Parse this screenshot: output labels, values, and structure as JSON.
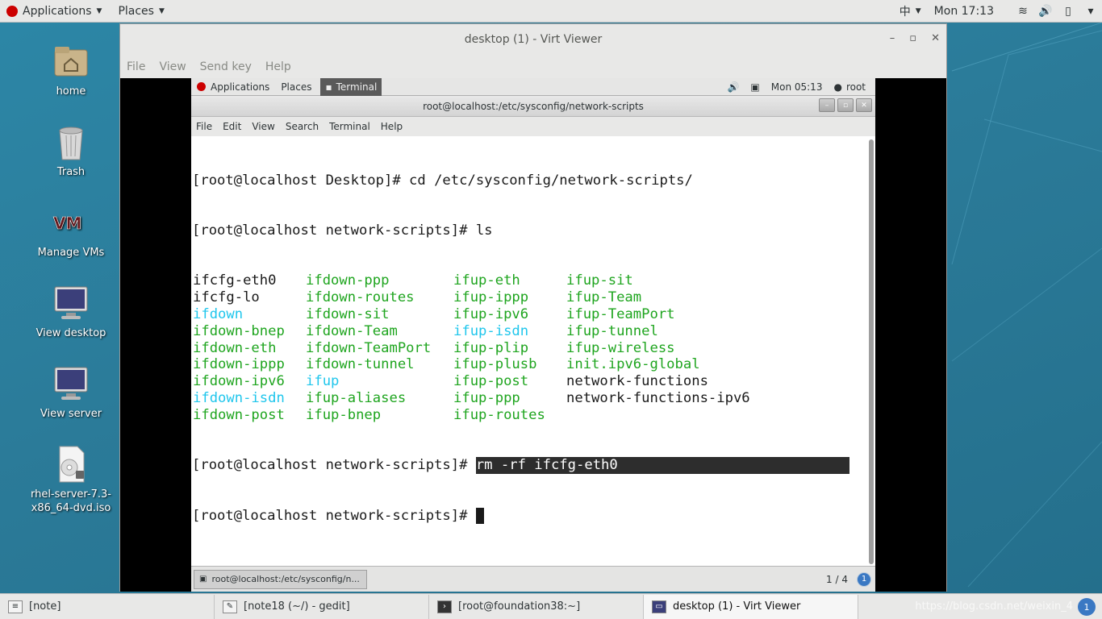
{
  "topbar": {
    "applications": "Applications",
    "places": "Places",
    "input_method": "中",
    "clock": "Mon 17:13"
  },
  "desktop_icons": [
    {
      "label": "home",
      "icon": "home-folder-icon"
    },
    {
      "label": "Trash",
      "icon": "trash-icon"
    },
    {
      "label": "Manage VMs",
      "icon": "virt-manager-icon"
    },
    {
      "label": "View desktop",
      "icon": "monitor-icon"
    },
    {
      "label": "View server",
      "icon": "monitor-icon"
    },
    {
      "label": "rhel-server-7.3-x86_64-dvd.iso",
      "line1": "rhel-server-7.3-",
      "line2": "x86_64-dvd.iso",
      "icon": "disc-image-icon"
    }
  ],
  "virt_viewer": {
    "title": "desktop (1) - Virt Viewer",
    "menu": [
      "File",
      "View",
      "Send key",
      "Help"
    ]
  },
  "guest": {
    "topbar": {
      "applications": "Applications",
      "places": "Places",
      "terminal": "Terminal",
      "clock": "Mon 05:13",
      "user": "root"
    },
    "window_title": "root@localhost:/etc/sysconfig/network-scripts",
    "menu": [
      "File",
      "Edit",
      "View",
      "Search",
      "Terminal",
      "Help"
    ],
    "terminal": {
      "line1": "[root@localhost Desktop]# cd /etc/sysconfig/network-scripts/",
      "line2": "[root@localhost network-scripts]# ls",
      "ls_rows": [
        [
          [
            "ifcfg-eth0",
            "w"
          ],
          [
            "ifdown-ppp",
            "g"
          ],
          [
            "ifup-eth",
            "g"
          ],
          [
            "ifup-sit",
            "g"
          ]
        ],
        [
          [
            "ifcfg-lo",
            "w"
          ],
          [
            "ifdown-routes",
            "g"
          ],
          [
            "ifup-ippp",
            "g"
          ],
          [
            "ifup-Team",
            "g"
          ]
        ],
        [
          [
            "ifdown",
            "cy"
          ],
          [
            "ifdown-sit",
            "g"
          ],
          [
            "ifup-ipv6",
            "g"
          ],
          [
            "ifup-TeamPort",
            "g"
          ]
        ],
        [
          [
            "ifdown-bnep",
            "g"
          ],
          [
            "ifdown-Team",
            "g"
          ],
          [
            "ifup-isdn",
            "cy"
          ],
          [
            "ifup-tunnel",
            "g"
          ]
        ],
        [
          [
            "ifdown-eth",
            "g"
          ],
          [
            "ifdown-TeamPort",
            "g"
          ],
          [
            "ifup-plip",
            "g"
          ],
          [
            "ifup-wireless",
            "g"
          ]
        ],
        [
          [
            "ifdown-ippp",
            "g"
          ],
          [
            "ifdown-tunnel",
            "g"
          ],
          [
            "ifup-plusb",
            "g"
          ],
          [
            "init.ipv6-global",
            "g"
          ]
        ],
        [
          [
            "ifdown-ipv6",
            "g"
          ],
          [
            "ifup",
            "cy"
          ],
          [
            "ifup-post",
            "g"
          ],
          [
            "network-functions",
            "w"
          ]
        ],
        [
          [
            "ifdown-isdn",
            "cy"
          ],
          [
            "ifup-aliases",
            "g"
          ],
          [
            "ifup-ppp",
            "g"
          ],
          [
            "network-functions-ipv6",
            "w"
          ]
        ],
        [
          [
            "ifdown-post",
            "g"
          ],
          [
            "ifup-bnep",
            "g"
          ],
          [
            "ifup-routes",
            "g"
          ],
          [
            "",
            ""
          ]
        ]
      ],
      "prompt": "[root@localhost network-scripts]# ",
      "command_highlighted": "rm -rf ifcfg-eth0",
      "prompt2": "[root@localhost network-scripts]# "
    },
    "taskbar": {
      "task": "root@localhost:/etc/sysconfig/n...",
      "pager": "1 / 4",
      "badge": "1"
    }
  },
  "taskbar": {
    "tasks": [
      {
        "label": "[note]",
        "icon": "text-file-icon"
      },
      {
        "label": "[note18 (~/) - gedit]",
        "icon": "gedit-icon"
      },
      {
        "label": "[root@foundation38:~]",
        "icon": "terminal-icon"
      },
      {
        "label": "desktop (1) - Virt Viewer",
        "icon": "virt-viewer-icon"
      }
    ],
    "watermark": "https://blog.csdn.net/weixin_4",
    "pager": "1 / 4",
    "badge": "1"
  },
  "colors": {
    "ls_green": "#1fa51f",
    "ls_cyan": "#1fc6ec",
    "desktop": "#2a7f9e"
  }
}
